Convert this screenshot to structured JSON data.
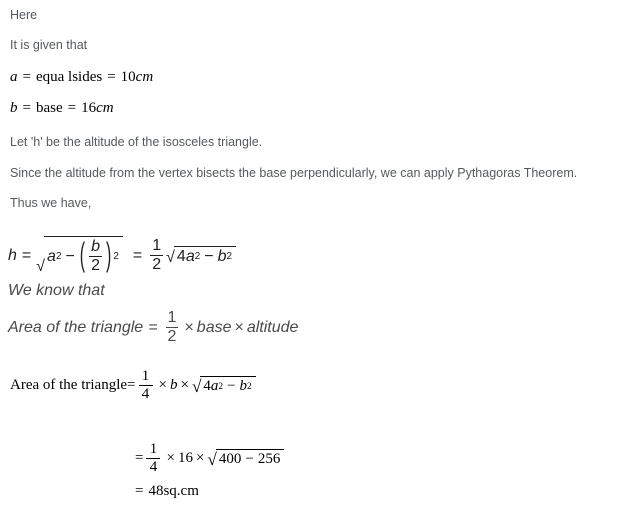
{
  "document": {
    "title": "Isosceles triangle area solution",
    "background_color": "#ffffff",
    "prose_color": "#55595e",
    "math_color": "#000000"
  },
  "prose_lines": [
    {
      "text": "Here"
    },
    {
      "text": "It is given that"
    },
    {
      "text": "Let 'h' be the altitude of the isosceles triangle."
    },
    {
      "text": "Since the altitude from the vertex bisects the base perpendicularly, we can apply Pythagoras Theorem."
    },
    {
      "text": "Thus we have,"
    }
  ],
  "givens": {
    "equal_sides": {
      "symbol": "a",
      "eq1": "=",
      "label": "equa lsides",
      "eq2": "=",
      "value": "10",
      "unit": "cm"
    },
    "base": {
      "symbol": "b",
      "eq1": "=",
      "label": "base",
      "eq2": "=",
      "value": "16",
      "unit": "cm"
    }
  },
  "altitude_equation": {
    "lhs": "h",
    "equals_1": "=",
    "a_sym": "a",
    "a_pow": "2",
    "minus": "−",
    "paren_open": "(",
    "paren_close": ")",
    "b_sym": "b",
    "two": "2",
    "paren_pow": "2",
    "equals_2": "=",
    "half_num": "1",
    "half_den": "2",
    "four": "4",
    "a_sym_2": "a",
    "a_pow_2": "2",
    "minus_2": "−",
    "b_sym_2": "b",
    "b_pow_2": "2"
  },
  "we_know_that": "We know that",
  "area_formula": {
    "label": "Area of the triangle",
    "equals": "=",
    "half_num": "1",
    "half_den": "2",
    "times_1": "×",
    "base_word": "base",
    "times_2": "×",
    "altitude_word": "altitude"
  },
  "area_substituted": {
    "label": "Area of the triangle=",
    "quarter_num": "1",
    "quarter_den": "4",
    "times_1": "×",
    "b_sym": "b",
    "times_2": "×",
    "four": "4",
    "a_sym": "a",
    "a_pow": "2",
    "minus": "−",
    "b_rad": "b",
    "b_pow": "2"
  },
  "area_numeric": {
    "equals": "=",
    "quarter_num": "1",
    "quarter_den": "4",
    "times_1": "×",
    "sixteen": "16",
    "times_2": "×",
    "value_a": "400",
    "minus": "−",
    "value_b": "256"
  },
  "area_result": {
    "equals": "=",
    "value": "48",
    "unit": "sq.cm"
  },
  "chart_data": null
}
